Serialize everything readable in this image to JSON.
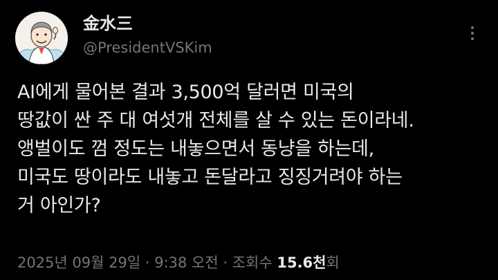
{
  "header": {
    "display_name": "金水三",
    "handle": "@PresidentVSKim",
    "avatar_icon": "cartoon-portrait-avatar",
    "more_icon": "more-options-icon"
  },
  "tweet": {
    "lines": [
      "AI에게 물어본 결과 3,500억 달러면 미국의",
      "땅값이 싼 주 대 여섯개 전체를 살 수 있는 돈이라네.",
      "앵벌이도 껌 정도는 내놓으면서 동냥을 하는데,",
      "미국도 땅이라도 내놓고 돈달라고 징징거려야 하는",
      "거 아인가?"
    ]
  },
  "meta": {
    "timestamp": "2025년 09월 29일 · 9:38 오전 · 조회수 ",
    "views_count": "15.6천",
    "views_suffix": "회"
  },
  "colors": {
    "background": "#000000",
    "primary_text": "#e7e9ea",
    "secondary_text": "#71767b"
  }
}
